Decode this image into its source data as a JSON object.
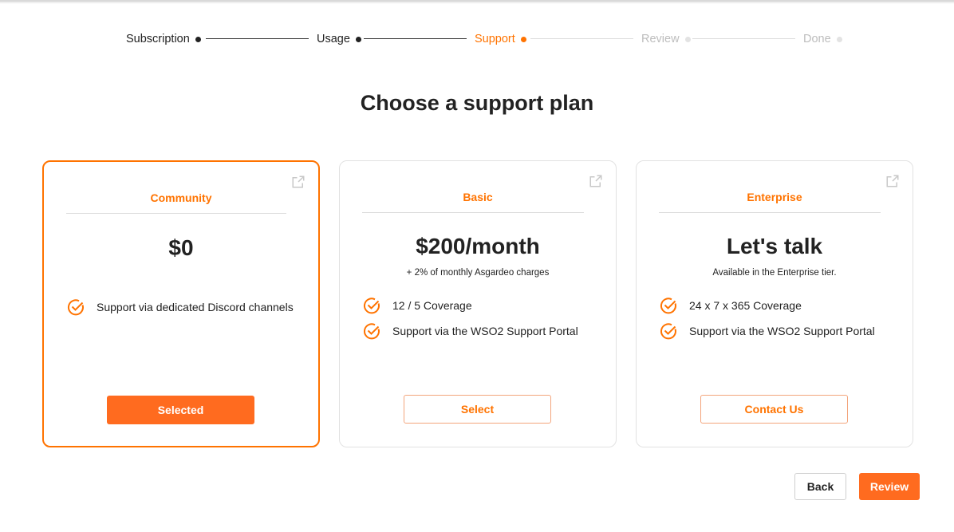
{
  "stepper": {
    "steps": [
      {
        "label": "Subscription",
        "state": "done"
      },
      {
        "label": "Usage",
        "state": "done"
      },
      {
        "label": "Support",
        "state": "active"
      },
      {
        "label": "Review",
        "state": "todo"
      },
      {
        "label": "Done",
        "state": "todo"
      }
    ]
  },
  "page_title": "Choose a support plan",
  "plans": [
    {
      "name": "Community",
      "price": "$0",
      "subtitle": "",
      "features": [
        "Support via dedicated Discord channels"
      ],
      "button_label": "Selected",
      "selected": true,
      "icon": "external-link-icon"
    },
    {
      "name": "Basic",
      "price": "$200/month",
      "subtitle": "+ 2% of monthly Asgardeo charges",
      "features": [
        "12 / 5 Coverage",
        "Support via the WSO2 Support Portal"
      ],
      "button_label": "Select",
      "selected": false,
      "icon": "external-link-icon"
    },
    {
      "name": "Enterprise",
      "price": "Let's talk",
      "subtitle": "Available in the Enterprise tier.",
      "features": [
        "24 x 7 x 365 Coverage",
        "Support via the WSO2 Support Portal"
      ],
      "button_label": "Contact Us",
      "selected": false,
      "icon": "external-link-icon"
    }
  ],
  "footer": {
    "back_label": "Back",
    "review_label": "Review"
  },
  "colors": {
    "accent": "#ff7300",
    "button_fill": "#ff6b1f",
    "feature_check": "#ff7300"
  }
}
